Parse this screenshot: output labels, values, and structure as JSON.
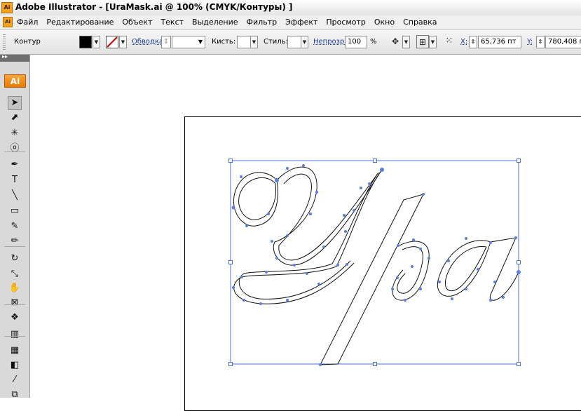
{
  "window": {
    "title": "Adobe Illustrator - [UraMask.ai @ 100% (CMYK/Контуры) ]",
    "app_icon": "Ai"
  },
  "menu": {
    "items": [
      "Файл",
      "Редактирование",
      "Объект",
      "Текст",
      "Выделение",
      "Фильтр",
      "Эффект",
      "Просмотр",
      "Окно",
      "Справка"
    ]
  },
  "control": {
    "selection_type": "Контур",
    "stroke_label": "Обводка:",
    "brush_label": "Кисть:",
    "style_label": "Стиль:",
    "opacity_label": "Непрозр.:",
    "opacity_value": "100",
    "opacity_unit": "%",
    "x_label": "X:",
    "x_value": "65,736 пт",
    "y_label": "Y:",
    "y_value": "780,408 пт",
    "fill_color": "#000000"
  },
  "toolbox": {
    "logo": "Ai",
    "tools": [
      {
        "name": "selection-tool",
        "glyph": "➤",
        "selected": true
      },
      {
        "name": "direct-selection-tool",
        "glyph": "⬈",
        "selected": false
      },
      {
        "name": "magic-wand-tool",
        "glyph": "✳",
        "selected": false
      },
      {
        "name": "lasso-tool",
        "glyph": "ⓞ",
        "selected": false
      },
      {
        "name": "pen-tool",
        "glyph": "✒",
        "selected": false
      },
      {
        "name": "type-tool",
        "glyph": "T",
        "selected": false
      },
      {
        "name": "line-segment-tool",
        "glyph": "╲",
        "selected": false
      },
      {
        "name": "rectangle-tool",
        "glyph": "▭",
        "selected": false
      },
      {
        "name": "paintbrush-tool",
        "glyph": "✎",
        "selected": false
      },
      {
        "name": "pencil-tool",
        "glyph": "✏",
        "selected": false
      },
      {
        "name": "rotate-tool",
        "glyph": "↻",
        "selected": false
      },
      {
        "name": "scale-tool",
        "glyph": "⤡",
        "selected": false
      },
      {
        "name": "warp-tool",
        "glyph": "✋",
        "selected": false
      },
      {
        "name": "free-transform-tool",
        "glyph": "⊠",
        "selected": false
      },
      {
        "name": "symbol-sprayer-tool",
        "glyph": "❖",
        "selected": false
      },
      {
        "name": "column-graph-tool",
        "glyph": "▥",
        "selected": false
      },
      {
        "name": "mesh-tool",
        "glyph": "▦",
        "selected": false
      },
      {
        "name": "gradient-tool",
        "glyph": "◧",
        "selected": false
      },
      {
        "name": "eyedropper-tool",
        "glyph": "⁄",
        "selected": false
      },
      {
        "name": "blend-tool",
        "glyph": "⧉",
        "selected": false
      }
    ]
  },
  "colors": {
    "selection_blue": "#4a72d8",
    "anchor_blue": "#5a7fdc",
    "accent_orange": "#f7a21b"
  }
}
